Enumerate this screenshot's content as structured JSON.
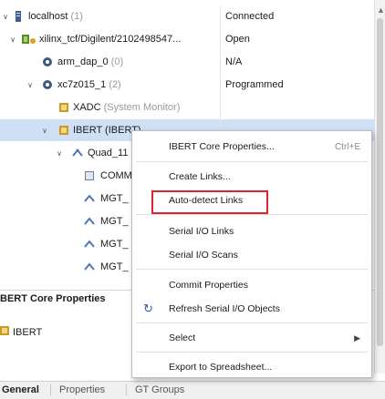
{
  "tree": {
    "rows": [
      {
        "label": "localhost",
        "sub": "(1)",
        "status": "Connected"
      },
      {
        "label": "xilinx_tcf/Digilent/2102498547...",
        "sub": "",
        "status": "Open"
      },
      {
        "label": "arm_dap_0",
        "sub": "(0)",
        "status": "N/A"
      },
      {
        "label": "xc7z015_1",
        "sub": "(2)",
        "status": "Programmed"
      },
      {
        "label": "XADC",
        "sub": "(System Monitor)",
        "status": ""
      },
      {
        "label": "IBERT (IBERT)",
        "sub": "",
        "status": ""
      },
      {
        "label": "Quad_11",
        "sub": "",
        "status": ""
      },
      {
        "label": "COMM",
        "sub": "",
        "status": ""
      },
      {
        "label": "MGT_",
        "sub": "",
        "status": ""
      },
      {
        "label": "MGT_",
        "sub": "",
        "status": ""
      },
      {
        "label": "MGT_",
        "sub": "",
        "status": ""
      },
      {
        "label": "MGT_",
        "sub": "",
        "status": ""
      }
    ]
  },
  "properties_panel": {
    "title": "BERT Core Properties",
    "item": "IBERT"
  },
  "tabs": [
    "General",
    "Properties",
    "GT Groups"
  ],
  "context_menu": {
    "items": [
      {
        "label": "IBERT Core Properties...",
        "shortcut": "Ctrl+E"
      },
      {
        "label": "Create Links..."
      },
      {
        "label": "Auto-detect Links"
      },
      {
        "label": "Serial I/O Links"
      },
      {
        "label": "Serial I/O Scans"
      },
      {
        "label": "Commit Properties"
      },
      {
        "label": "Refresh Serial I/O Objects"
      },
      {
        "label": "Select"
      },
      {
        "label": "Export to Spreadsheet..."
      }
    ]
  },
  "colors": {
    "selection": "#cfe0f5",
    "highlight_box": "#e0242c",
    "accent": "#2a5caa"
  },
  "icons": [
    "expand-toggle-icon",
    "server-icon",
    "cable-icon",
    "chip-icon",
    "ip-core-icon",
    "quad-icon",
    "comm-icon",
    "mgt-icon",
    "refresh-icon",
    "submenu-arrow-icon"
  ]
}
